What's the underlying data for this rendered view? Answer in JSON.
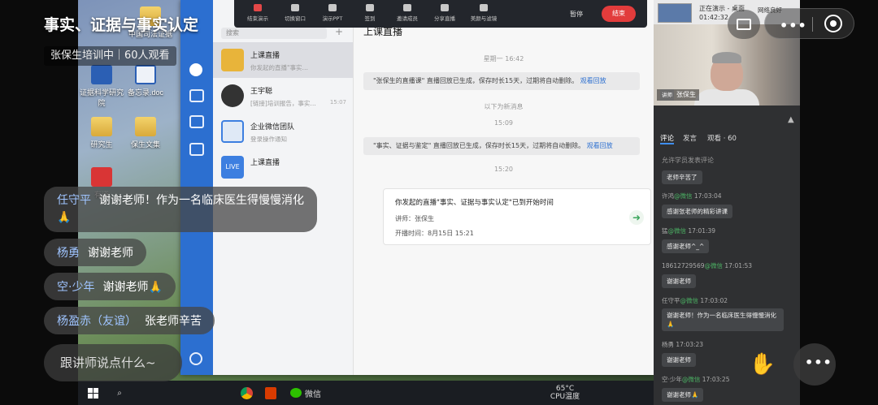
{
  "live": {
    "title": "事实、证据与事实认定",
    "subtitle": "张保生培训中｜60人观看"
  },
  "desktop": {
    "icons": [
      {
        "label": "中国司法证据",
        "icon": "folder"
      },
      {
        "label": "证据科学研究院",
        "icon": "doc"
      },
      {
        "label": "备忘录.doc",
        "icon": "docw"
      },
      {
        "label": "研究生",
        "icon": "folder"
      },
      {
        "label": "保生文集",
        "icon": "folder"
      },
      {
        "label": "有道",
        "icon": "red"
      }
    ],
    "taskbar": {
      "wechat_label": "微信",
      "weather_temp": "65°C",
      "weather_label": "CPU温度"
    }
  },
  "presenter_toolbar": {
    "items": [
      "结束演示",
      "切换窗口",
      "演示PPT",
      "签到",
      "邀请成员",
      "分享直播",
      "美颜与滤镜"
    ],
    "pause_label": "暂停",
    "end_label": "结束"
  },
  "wecom": {
    "search_placeholder": "搜索",
    "conversations": [
      {
        "name": "上课直播",
        "preview": "你发起的直播\"事实…",
        "time": "",
        "avatar_color": "#e8b43a"
      },
      {
        "name": "王宇聪",
        "preview": "[链接]培训报告，事实…",
        "time": "15:07",
        "avatar_color": "#333333"
      },
      {
        "name": "企业微信团队",
        "preview": "登录操作通知",
        "time": "",
        "avatar_color": "#dfe9f6"
      },
      {
        "name": "上课直播",
        "preview": "",
        "time": "",
        "avatar_color": "#3d7fe0",
        "avatar_text": "LIVE"
      }
    ],
    "chat": {
      "title": "上课直播",
      "time1": "星期一 16:42",
      "msg1_text": "\"张保生的直播课\" 直播回放已生成，保存时长15天，过期将自动删除。",
      "msg1_link": "观看回放",
      "new_messages": "以下为新消息",
      "time2": "15:09",
      "msg2_text": "\"事实、证据与鉴定\" 直播回放已生成，保存时长15天，过期将自动删除。",
      "msg2_link": "观看回放",
      "time3": "15:20",
      "card_title": "你发起的直播\"事实、证据与事实认定\"已到开始时间",
      "card_speaker": "讲师：张保生",
      "card_start": "开播时间：8月15日 15:21"
    }
  },
  "right_panel": {
    "status_line1": "正在演示 - 桌面",
    "status_line2": "01:42:32",
    "status_network": "网络良好",
    "presenter_badge": "讲师",
    "presenter_name": "张保生",
    "tabs": [
      "评论",
      "发言",
      "观看 · 60"
    ],
    "comment_placeholder": "允许学员发表评论",
    "comments": [
      {
        "user": "",
        "wx": "",
        "time": "",
        "text": "老师辛苦了"
      },
      {
        "user": "许鸿",
        "wx": "@微信",
        "time": "17:03:04",
        "text": "感谢张老师的精彩讲课"
      },
      {
        "user": "猛",
        "wx": "@微信",
        "time": "17:01:39",
        "text": "感谢老师^_^"
      },
      {
        "user": "18612729569",
        "wx": "@微信",
        "time": "17:01:53",
        "text": "谢谢老师"
      },
      {
        "user": "任守平",
        "wx": "@微信",
        "time": "17:03:02",
        "text": "谢谢老师！作为一名临床医生得慢慢消化🙏"
      },
      {
        "user": "杨勇",
        "wx": "",
        "time": "17:03:23",
        "text": "谢谢老师"
      },
      {
        "user": "空·少年",
        "wx": "@微信",
        "time": "17:03:25",
        "text": "谢谢老师🙏"
      }
    ]
  },
  "overlay_comments": [
    {
      "user": "任守平",
      "text": "谢谢老师！作为一名临床医生得慢慢消化🙏"
    },
    {
      "user": "杨勇",
      "text": "谢谢老师"
    },
    {
      "user": "空·少年",
      "text": "谢谢老师🙏"
    },
    {
      "user": "杨盈赤（友谊）",
      "text": "张老师辛苦"
    }
  ],
  "comment_input_placeholder": "跟讲师说点什么~"
}
